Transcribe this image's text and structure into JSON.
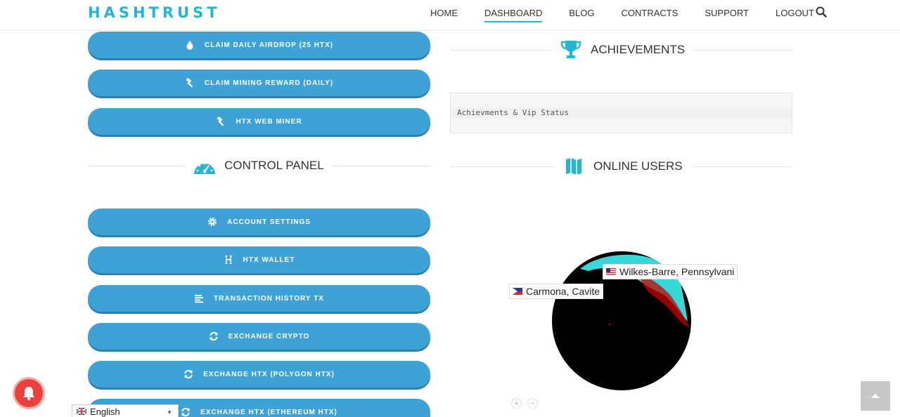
{
  "header": {
    "logo_text": "HASHTRUST",
    "nav": [
      {
        "label": "HOME"
      },
      {
        "label": "DASHBOARD"
      },
      {
        "label": "BLOG"
      },
      {
        "label": "CONTRACTS"
      },
      {
        "label": "SUPPORT"
      },
      {
        "label": "LOGOUT"
      }
    ],
    "active_nav": "DASHBOARD"
  },
  "left_buttons_top": [
    {
      "label": "CLAIM DAILY AIRDROP (25 HTX)",
      "icon": "drop-icon"
    },
    {
      "label": "CLAIM MINING REWARD (DAILY)",
      "icon": "hammer-icon"
    },
    {
      "label": "HTX WEB MINER",
      "icon": "hammer-icon"
    }
  ],
  "control_panel": {
    "title": "CONTROL PANEL",
    "buttons": [
      {
        "label": "ACCOUNT SETTINGS",
        "icon": "gear-icon"
      },
      {
        "label": "HTX WALLET",
        "icon": "h-icon"
      },
      {
        "label": "TRANSACTION HISTORY TX",
        "icon": "list-icon"
      },
      {
        "label": "EXCHANGE CRYPTO",
        "icon": "refresh-icon"
      },
      {
        "label": "EXCHANGE HTX (POLYGON HTX)",
        "icon": "refresh-icon"
      },
      {
        "label": "EXCHANGE HTX (ETHEREUM HTX)",
        "icon": "refresh-icon"
      }
    ]
  },
  "achievements": {
    "title": "ACHIEVEMENTS",
    "content": "Achievments & Vip Status"
  },
  "online_users": {
    "title": "ONLINE USERS",
    "locations": [
      {
        "label": "Wilkes-Barre, Pennsylvani",
        "flag": "us-flag-icon"
      },
      {
        "label": "Carmona, Cavite",
        "flag": "ph-flag-icon"
      }
    ],
    "zoom_in": "+",
    "zoom_out": "−"
  },
  "language": {
    "selected": "English"
  },
  "colors": {
    "accent": "#23b5d3",
    "button": "#3fa2d7",
    "button_shadow": "#2f7fae",
    "bell": "#e9423c"
  }
}
